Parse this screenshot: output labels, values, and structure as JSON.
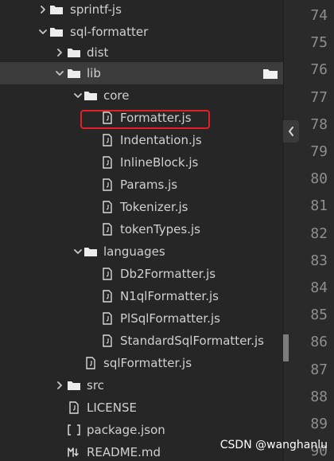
{
  "tree": {
    "rows": [
      {
        "label": "sprintf-js",
        "icon": "folder-icon",
        "arrow": "chevron-right-icon"
      },
      {
        "label": "sql-formatter",
        "icon": "folder-open-icon",
        "arrow": "chevron-down-icon"
      },
      {
        "label": "dist",
        "icon": "folder-icon",
        "arrow": "chevron-right-icon"
      },
      {
        "label": "lib",
        "icon": "folder-open-icon",
        "arrow": "chevron-down-icon",
        "selected": true
      },
      {
        "label": "core",
        "icon": "folder-open-icon",
        "arrow": "chevron-down-icon"
      },
      {
        "label": "Formatter.js",
        "icon": "file-icon"
      },
      {
        "label": "Indentation.js",
        "icon": "file-icon"
      },
      {
        "label": "InlineBlock.js",
        "icon": "file-icon"
      },
      {
        "label": "Params.js",
        "icon": "file-icon"
      },
      {
        "label": "Tokenizer.js",
        "icon": "file-icon"
      },
      {
        "label": "tokenTypes.js",
        "icon": "file-icon"
      },
      {
        "label": "languages",
        "icon": "folder-open-icon",
        "arrow": "chevron-down-icon"
      },
      {
        "label": "Db2Formatter.js",
        "icon": "file-icon"
      },
      {
        "label": "N1qlFormatter.js",
        "icon": "file-icon"
      },
      {
        "label": "PlSqlFormatter.js",
        "icon": "file-icon"
      },
      {
        "label": "StandardSqlFormatter.js",
        "icon": "file-icon"
      },
      {
        "label": "sqlFormatter.js",
        "icon": "file-icon"
      },
      {
        "label": "src",
        "icon": "folder-icon",
        "arrow": "chevron-right-icon"
      },
      {
        "label": "LICENSE",
        "icon": "license-file-icon"
      },
      {
        "label": "package.json",
        "icon": "json-file-icon"
      },
      {
        "label": "README.md",
        "icon": "markdown-file-icon"
      }
    ]
  },
  "gutter": {
    "line_numbers": [
      "74",
      "75",
      "76",
      "77",
      "78",
      "79",
      "80",
      "81",
      "82",
      "83",
      "84",
      "85",
      "86",
      "87",
      "88",
      "89",
      "90"
    ]
  },
  "watermark": "CSDN @wanghanlu"
}
